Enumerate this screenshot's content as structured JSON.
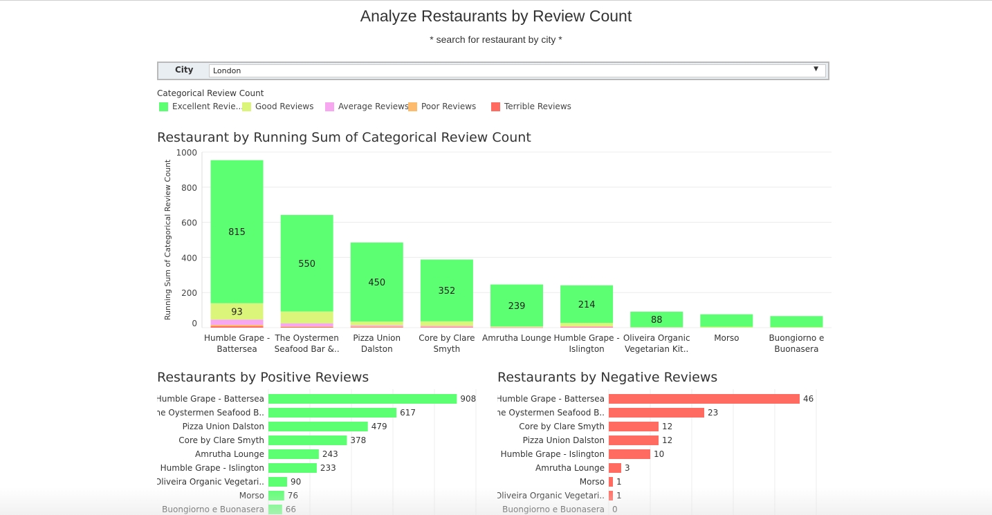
{
  "header": {
    "title": "Analyze Restaurants by Review Count",
    "subtitle": "* search for restaurant by city *"
  },
  "filter": {
    "label": "City",
    "value": "London",
    "icon": "chevron-down-icon"
  },
  "legend": {
    "title": "Categorical Review Count",
    "items": [
      {
        "label": "Excellent Revie...",
        "color": "#5cff72"
      },
      {
        "label": "Good Reviews",
        "color": "#dbf57a"
      },
      {
        "label": "Average Reviews",
        "color": "#f7a6f0"
      },
      {
        "label": "Poor Reviews",
        "color": "#fdbb6e"
      },
      {
        "label": "Terrible Reviews",
        "color": "#ff6b61"
      }
    ]
  },
  "chart_data": [
    {
      "type": "bar",
      "stacked": true,
      "title": "Restaurant by Running Sum of Categorical Review Count",
      "ylabel": "Running Sum of Categorical Review Count",
      "ylim": [
        0,
        1000
      ],
      "yticks": [
        0,
        200,
        400,
        600,
        800,
        1000
      ],
      "grid": true,
      "categories": [
        [
          "Humble Grape -",
          "Battersea"
        ],
        [
          "The Oystermen",
          "Seafood Bar &.."
        ],
        [
          "Pizza Union",
          "Dalston"
        ],
        [
          "Core by Clare",
          "Smyth"
        ],
        [
          "Amrutha Lounge"
        ],
        [
          "Humble Grape -",
          "Islington"
        ],
        [
          "Oliveira Organic",
          "Vegetarian Kit.."
        ],
        [
          "Morso"
        ],
        [
          "Buongiorno e",
          "Buonasera"
        ]
      ],
      "series": [
        {
          "name": "Terrible Reviews",
          "color": "#ff6b61",
          "values": [
            8,
            4,
            3,
            2,
            1,
            2,
            0,
            0,
            0
          ]
        },
        {
          "name": "Poor Reviews",
          "color": "#fdbb6e",
          "values": [
            8,
            3,
            3,
            2,
            1,
            2,
            0,
            0,
            0
          ]
        },
        {
          "name": "Average Reviews",
          "color": "#f7a6f0",
          "values": [
            30,
            18,
            7,
            6,
            1,
            4,
            1,
            0,
            0
          ]
        },
        {
          "name": "Good Reviews",
          "color": "#dbf57a",
          "values": [
            93,
            67,
            22,
            26,
            4,
            19,
            2,
            5,
            3
          ]
        },
        {
          "name": "Excellent Reviews",
          "color": "#5cff72",
          "values": [
            815,
            550,
            450,
            352,
            239,
            214,
            88,
            71,
            63
          ]
        }
      ],
      "data_labels": [
        {
          "category_index": 0,
          "series": "Excellent Reviews",
          "text": "815"
        },
        {
          "category_index": 0,
          "series": "Good Reviews",
          "text": "93"
        },
        {
          "category_index": 1,
          "series": "Excellent Reviews",
          "text": "550"
        },
        {
          "category_index": 2,
          "series": "Excellent Reviews",
          "text": "450"
        },
        {
          "category_index": 3,
          "series": "Excellent Reviews",
          "text": "352"
        },
        {
          "category_index": 4,
          "series": "Excellent Reviews",
          "text": "239"
        },
        {
          "category_index": 5,
          "series": "Excellent Reviews",
          "text": "214"
        },
        {
          "category_index": 6,
          "series": "Excellent Reviews",
          "text": "88"
        }
      ]
    },
    {
      "type": "bar",
      "orientation": "horizontal",
      "title": "Restaurants by Positive Reviews",
      "color": "#5cff72",
      "xlim": [
        0,
        1000
      ],
      "grid": true,
      "categories": [
        "Humble Grape - Battersea",
        "The Oystermen Seafood B..",
        "Pizza Union Dalston",
        "Core by Clare Smyth",
        "Amrutha Lounge",
        "Humble Grape - Islington",
        "Oliveira Organic Vegetari..",
        "Morso",
        "Buongiorno e Buonasera"
      ],
      "values": [
        908,
        617,
        479,
        378,
        243,
        233,
        90,
        76,
        66
      ]
    },
    {
      "type": "bar",
      "orientation": "horizontal",
      "title": "Restaurants by Negative Reviews",
      "color": "#ff6b61",
      "xlim": [
        0,
        50
      ],
      "grid": true,
      "categories": [
        "Humble Grape - Battersea",
        "The Oystermen Seafood B..",
        "Core by Clare Smyth",
        "Pizza Union Dalston",
        "Humble Grape - Islington",
        "Amrutha Lounge",
        "Morso",
        "Oliveira Organic Vegetari..",
        "Buongiorno e Buonasera"
      ],
      "values": [
        46,
        23,
        12,
        12,
        10,
        3,
        1,
        1,
        0
      ]
    }
  ]
}
